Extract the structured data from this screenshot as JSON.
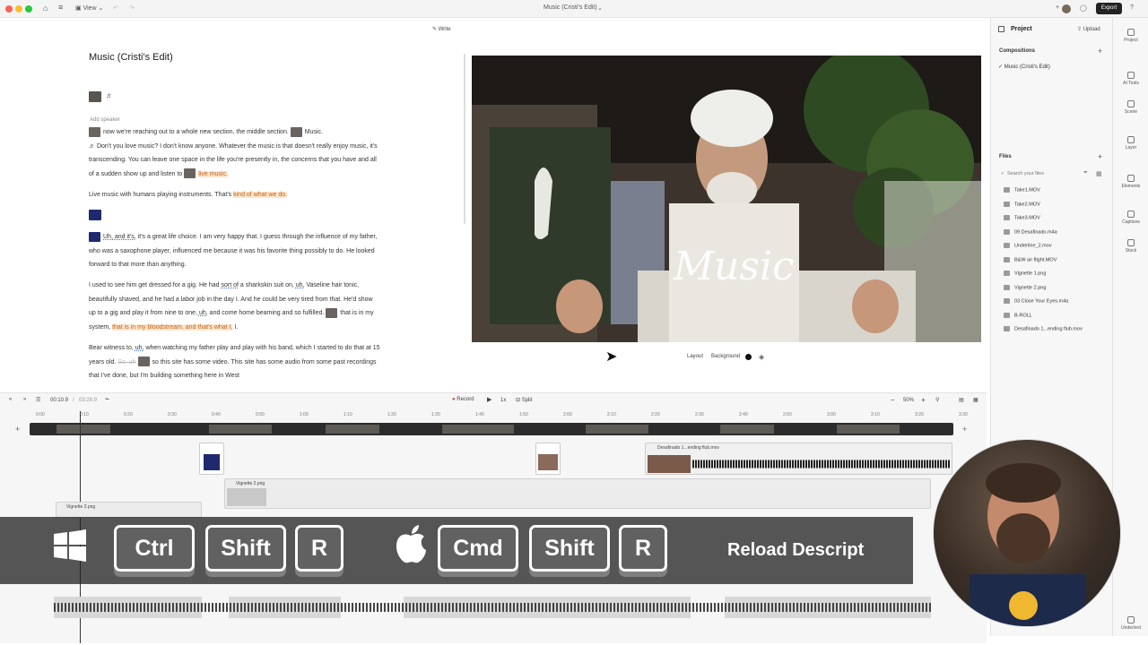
{
  "titlebar": {
    "view_label": "View",
    "doc_title": "Music (Cristi's Edit)",
    "export_label": "Export"
  },
  "doc": {
    "write_label": "Write",
    "title": "Music (Cristi's Edit)",
    "add_speaker": "Add speaker",
    "p1a": "now we're reaching out to a whole new section, the middle section.",
    "p1b": "Music.",
    "p1c": "Don't you love music? I don't know anyone. Whatever the music is that doesn't really enjoy music, it's transcending. You can leave one space in the life you're presently in, the concerns that you have and all of a sudden show up and listen to",
    "p1d": "live music.",
    "p2a": "Live music with humans playing instruments. That's",
    "p2b": "kind of what we do.",
    "p3a": "Uh, and it's,",
    "p3b": "it's a great life choice. I am very happy that. I guess through the influence of my father, who was a saxophone player, influenced me because it was his favorite thing possibly to do. He looked forward to that more than anything.",
    "p4a": "I used to see him get dressed for a gig. He had",
    "p4b": "sort of",
    "p4c": "a sharkskin suit on,",
    "p4d": "uh,",
    "p4e": "Vaseline hair tonic, beautifully shaved, and he had a labor job in the day I. And he could be very tired from that. He'd show up to a gig and play it from nine to one,",
    "p4f": "uh,",
    "p4g": "and come home beaming and so fulfilled.",
    "p4h": "that is in my system,",
    "p4i": "that is in my bloodstream, and that's what I,",
    "p4j": "I.",
    "p5a": "Bear witness to,",
    "p5b": "uh,",
    "p5c": "when watching my father play and play with his band, which I started to do that at 15 years old.",
    "p5d": "So, uh",
    "p5e": "so this site has some video. This site has some audio from some past recordings that I've done, but I'm building something here in West"
  },
  "preview": {
    "overlay_text": "Music",
    "layout_label": "Layout",
    "background_label": "Background"
  },
  "project": {
    "title": "Project",
    "upload_label": "Upload",
    "compositions_label": "Compositions",
    "composition_item": "Music (Cristi's Edit)",
    "files_label": "Files",
    "search_placeholder": "Search your files",
    "files": [
      "Take1.MOV",
      "Take2.MOV",
      "Take3.MOV",
      "09 Desafinado.m4a",
      "Underline_2.mov",
      "B&W air flight.MOV",
      "Vignette 1.png",
      "Vignette 2.png",
      "03 Close Your Eyes.m4a",
      "B-ROLL",
      "Desafinado 1...ending flub.mov"
    ]
  },
  "rail": {
    "items": [
      "Project",
      "AI Tools",
      "Scene",
      "Layer",
      "Elements",
      "Captions",
      "Stock",
      "Underlord"
    ]
  },
  "timeline": {
    "current_time": "00:10.9",
    "total_time": "03:28.9",
    "record_label": "Record",
    "speed_label": "1x",
    "split_label": "Split",
    "zoom_label": "50%",
    "ticks": [
      "0:00",
      "0:10",
      "0:20",
      "0:30",
      "0:40",
      "0:50",
      "1:00",
      "1:10",
      "1:20",
      "1:30",
      "1:40",
      "1:50",
      "2:00",
      "2:10",
      "2:20",
      "2:30",
      "2:40",
      "2:50",
      "3:00",
      "3:10",
      "3:20",
      "3:30"
    ],
    "clip_desafinado": "Desafinado 1...ending flub.mov",
    "clip_vignette": "Vignette 2.png",
    "clip_vignette_small": "Vignette 2.png"
  },
  "overlay": {
    "keys_win": [
      "Ctrl",
      "Shift",
      "R"
    ],
    "keys_mac": [
      "Cmd",
      "Shift",
      "R"
    ],
    "caption": "Reload Descript"
  },
  "colors": {
    "accent_highlight": "#fde6cf",
    "highlight_text": "#c2621a",
    "record_red": "#e0443a"
  }
}
